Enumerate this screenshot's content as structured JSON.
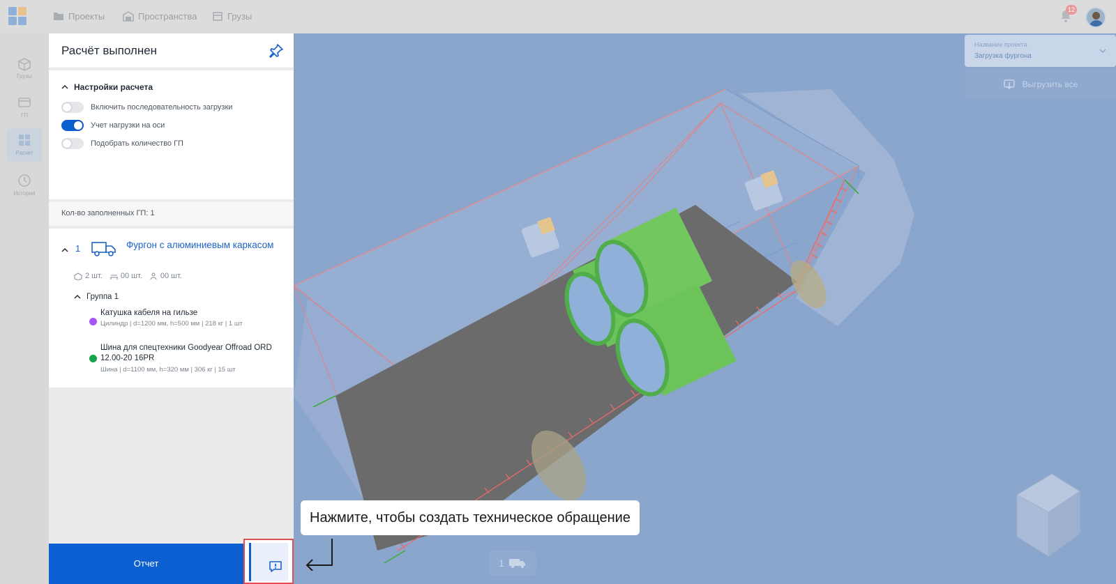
{
  "colors": {
    "accent": "#0c5fd1",
    "link": "#1e63c7",
    "highlight": "#e05050",
    "viewport_bg": "#8ba6cc"
  },
  "topbar": {
    "nav": [
      {
        "label": "Проекты",
        "icon": "folder-icon"
      },
      {
        "label": "Пространства",
        "icon": "warehouse-icon"
      },
      {
        "label": "Грузы",
        "icon": "box-icon"
      }
    ],
    "notifications_count": "12",
    "notifications_icon": "bell-icon",
    "avatar_icon": "user-avatar-icon"
  },
  "rail": [
    {
      "label": "Грузы",
      "icon": "cargo-icon",
      "active": false
    },
    {
      "label": "ГП",
      "icon": "truck-space-icon",
      "active": false
    },
    {
      "label": "Расчет",
      "icon": "grid-icon",
      "active": true
    },
    {
      "label": "История",
      "icon": "clock-icon",
      "active": false
    }
  ],
  "panel": {
    "title": "Расчёт выполнен",
    "pin_icon": "pin-icon",
    "settings": {
      "title": "Настройки расчета",
      "toggles": [
        {
          "label": "Включить последовательность загрузки",
          "on": false
        },
        {
          "label": "Учет нагрузки на оси",
          "on": true
        },
        {
          "label": "Подобрать количество ГП",
          "on": false
        }
      ]
    },
    "filled_count": "Кол-во заполненных ГП: 1",
    "vehicle": {
      "number": "1",
      "name": "Фургон с алюминиевым каркасом",
      "stats": [
        "2 шт.",
        "00 шт.",
        "00 шт."
      ],
      "group": {
        "title": "Группа 1",
        "items": [
          {
            "name": "Катушка кабеля на гильзе",
            "desc": "Цилиндр | d=1200 мм, h=500 мм | 218 кг | 1 шт",
            "color": "#a855f7"
          },
          {
            "name": "Шина для спецтехники Goodyear Offroad ORD 12.00-20 16PR",
            "desc": "Шина | d=1100 мм, h=320 мм | 306 кг | 15 шт",
            "color": "#16a34a"
          }
        ]
      }
    }
  },
  "buttons": {
    "report": "Отчет",
    "issue_icon": "alert-message-icon"
  },
  "tooltip": "Нажмите, чтобы создать техническое обращение",
  "project_select": {
    "label": "Название проекта",
    "value": "Загрузка фургона"
  },
  "unload_button": "Выгрузить все",
  "truck_chip": "1"
}
